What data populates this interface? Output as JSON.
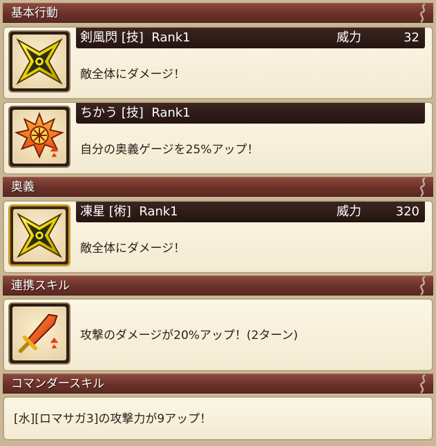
{
  "sections": {
    "basic": {
      "title": "基本行動"
    },
    "ougi": {
      "title": "奥義"
    },
    "link": {
      "title": "連携スキル"
    },
    "commander": {
      "title": "コマンダースキル"
    }
  },
  "skills": {
    "kenpuusen": {
      "name": "剣風閃 [技]  Rank1",
      "power_label": "威力",
      "power": "32",
      "description": "敵全体にダメージ！",
      "icon": "shuriken-icon"
    },
    "chikau": {
      "name": "ちかう [技]  Rank1",
      "description": "自分の奥義ゲージを25%アップ！",
      "icon": "burst-emblem-icon"
    },
    "tousei": {
      "name": "凍星 [術]  Rank1",
      "power_label": "威力",
      "power": "320",
      "description": "敵全体にダメージ！",
      "icon": "shuriken-icon"
    },
    "link_skill": {
      "description": "攻撃のダメージが20%アップ！(2ターン)",
      "icon": "sword-up-icon"
    },
    "commander_skill": {
      "description": "[水][ロマサガ3]の攻撃力が9アップ！"
    }
  }
}
